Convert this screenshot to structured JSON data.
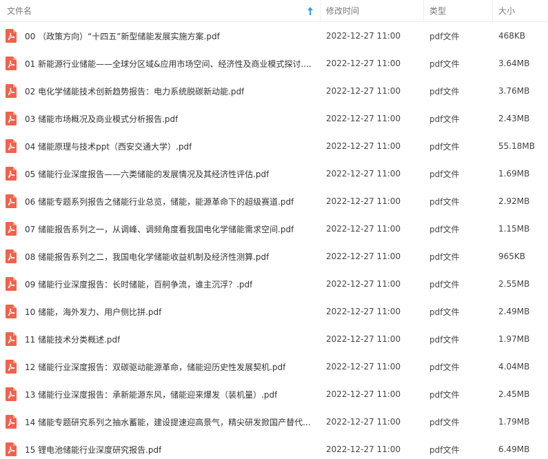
{
  "header": {
    "name": "文件名",
    "date": "修改时间",
    "type": "类型",
    "size": "大小",
    "sort_icon": "sort-up-arrow-icon"
  },
  "colors": {
    "pdf_icon": "#f0624d",
    "sort_arrow": "#2e9bf0"
  },
  "files": [
    {
      "name": "00 （政策方向）“十四五”新型储能发展实施方案.pdf",
      "date": "2022-12-27 11:00",
      "type": "pdf文件",
      "size": "468KB"
    },
    {
      "name": "01 新能源行业储能——全球分区域&应用市场空间、经济性及商业模式探讨....",
      "date": "2022-12-27 11:00",
      "type": "pdf文件",
      "size": "3.64MB"
    },
    {
      "name": "02 电化学储能技术创新趋势报告：电力系统脱碳新动能.pdf",
      "date": "2022-12-27 11:00",
      "type": "pdf文件",
      "size": "3.76MB"
    },
    {
      "name": "03 储能市场概况及商业模式分析报告.pdf",
      "date": "2022-12-27 11:00",
      "type": "pdf文件",
      "size": "2.43MB"
    },
    {
      "name": "04 储能原理与技术ppt（西安交通大学）.pdf",
      "date": "2022-12-27 11:00",
      "type": "pdf文件",
      "size": "55.18MB"
    },
    {
      "name": "05 储能行业深度报告——六类储能的发展情况及其经济性评估.pdf",
      "date": "2022-12-27 11:00",
      "type": "pdf文件",
      "size": "1.69MB"
    },
    {
      "name": "06 储能专题系列报告之储能行业总览，储能，能源革命下的超级赛道.pdf",
      "date": "2022-12-27 11:00",
      "type": "pdf文件",
      "size": "2.92MB"
    },
    {
      "name": "07 储能报告系列之一，从调峰、调频角度看我国电化学储能需求空间.pdf",
      "date": "2022-12-27 11:00",
      "type": "pdf文件",
      "size": "1.15MB"
    },
    {
      "name": "08 储能报告系列之二，我国电化学储能收益机制及经济性测算.pdf",
      "date": "2022-12-27 11:00",
      "type": "pdf文件",
      "size": "965KB"
    },
    {
      "name": "09 储能行业深度报告：长时储能，百舸争流，谁主沉浮？.pdf",
      "date": "2022-12-27 11:00",
      "type": "pdf文件",
      "size": "2.55MB"
    },
    {
      "name": "10 储能，海外发力、用户侧比拼.pdf",
      "date": "2022-12-27 11:00",
      "type": "pdf文件",
      "size": "2.49MB"
    },
    {
      "name": "11 储能技术分类概述.pdf",
      "date": "2022-12-27 11:00",
      "type": "pdf文件",
      "size": "1.97MB"
    },
    {
      "name": "12 储能行业深度报告：双碳驱动能源革命，储能迎历史性发展契机.pdf",
      "date": "2022-12-27 11:00",
      "type": "pdf文件",
      "size": "4.04MB"
    },
    {
      "name": "13 储能行业深度报告：承新能源东风，储能迎来爆发（装机量）.pdf",
      "date": "2022-12-27 11:00",
      "type": "pdf文件",
      "size": "2.45MB"
    },
    {
      "name": "14 储能专题研究系列之抽水蓄能，建设提速迎高景气，精尖研发掀国产替代...",
      "date": "2022-12-27 11:00",
      "type": "pdf文件",
      "size": "1.79MB"
    },
    {
      "name": "15 锂电池储能行业深度研究报告.pdf",
      "date": "2022-12-27 11:00",
      "type": "pdf文件",
      "size": "6.49MB"
    }
  ]
}
